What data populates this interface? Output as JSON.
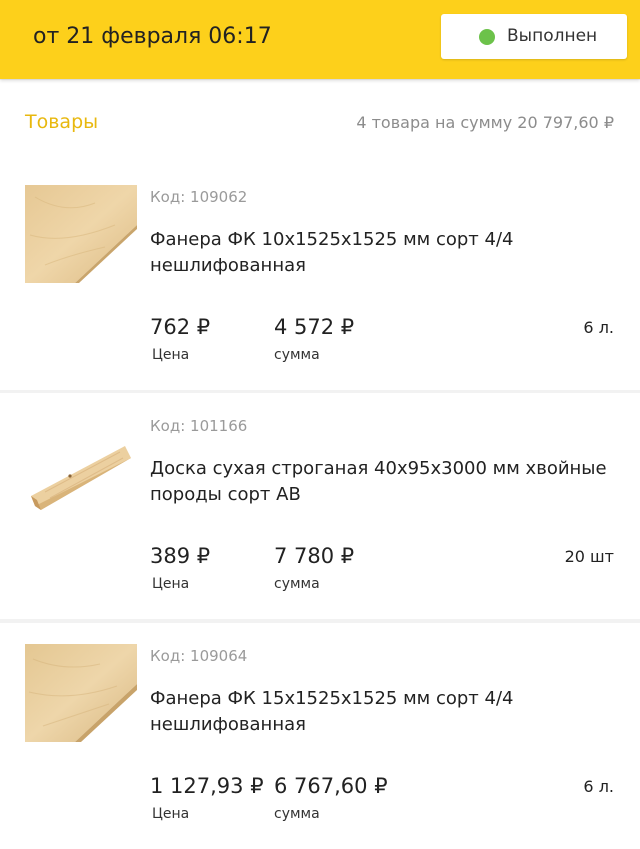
{
  "header": {
    "date": "от 21 февраля 06:17",
    "status": "Выполнен",
    "status_color": "#6cc24a",
    "accent_color": "#fdd01b"
  },
  "summary": {
    "title": "Товары",
    "total": "4 товара на сумму 20 797,60 ₽"
  },
  "items": [
    {
      "code": "Код: 109062",
      "name": "Фанера ФК 10х1525х1525 мм сорт 4/4 нешлифованная",
      "price": "762 ₽",
      "price_label": "Цена",
      "sum": "4 572 ₽",
      "sum_label": "сумма",
      "qty": "6 л.",
      "image": "plywood-sheet"
    },
    {
      "code": "Код: 101166",
      "name": "Доска сухая строганая 40х95х3000 мм хвойные породы сорт АВ",
      "price": "389 ₽",
      "price_label": "Цена",
      "sum": "7 780 ₽",
      "sum_label": "сумма",
      "qty": "20 шт",
      "image": "wooden-board"
    },
    {
      "code": "Код: 109064",
      "name": "Фанера ФК 15х1525х1525 мм сорт 4/4 нешлифованная",
      "price": "1 127,93 ₽",
      "price_label": "Цена",
      "sum": "6 767,60 ₽",
      "sum_label": "сумма",
      "qty": "6 л.",
      "image": "plywood-sheet"
    }
  ]
}
